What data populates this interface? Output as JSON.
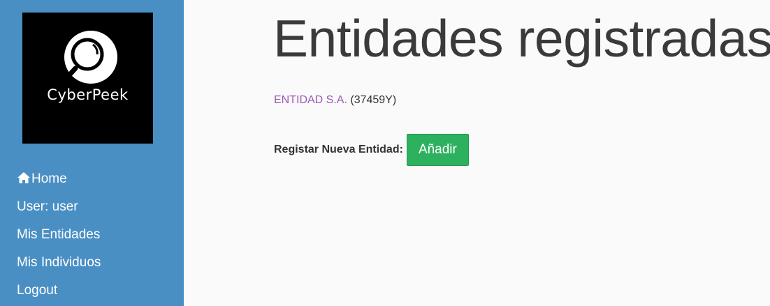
{
  "sidebar": {
    "logo_text": "CyberPeek",
    "items": [
      {
        "label": "Home",
        "icon": "home-icon"
      },
      {
        "label": "User: user"
      },
      {
        "label": "Mis Entidades"
      },
      {
        "label": "Mis Individuos"
      },
      {
        "label": "Logout"
      }
    ]
  },
  "main": {
    "title": "Entidades registradas",
    "entities": [
      {
        "name": "ENTIDAD S.A.",
        "id": "(37459Y)"
      }
    ],
    "register": {
      "label": "Registar Nueva Entidad:",
      "button_label": "Añadir"
    }
  },
  "colors": {
    "sidebar_bg": "#4a8fc4",
    "link": "#9b59b6",
    "button_bg": "#2eb15f"
  }
}
